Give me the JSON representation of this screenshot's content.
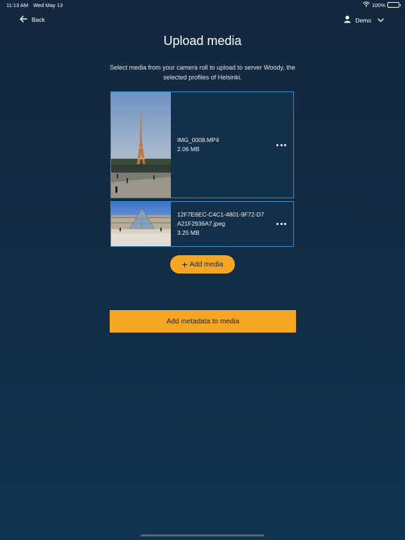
{
  "status_bar": {
    "time": "11:13 AM",
    "date": "Wed May 13",
    "battery": "100%",
    "battery_level": 1.0,
    "wifi_icon": "wifi-icon",
    "battery_icon": "battery-icon"
  },
  "nav": {
    "back_label": "Back",
    "back_icon": "arrow-left-icon",
    "user_label": "Demo",
    "user_icon": "person-icon",
    "chevron_icon": "chevron-down-icon"
  },
  "page": {
    "title": "Upload media",
    "instructions": "Select media from your camera roll to upload to server Woody, the selected profiles of Helsinki."
  },
  "media_items": [
    {
      "name": "IMG_0008.MP4",
      "size": "2.06 MB",
      "more_icon": "more-horizontal-icon"
    },
    {
      "name": "12F7E6EC-C4C1-4801-9F72-D7A21F2936A7.jpeg",
      "size": "3.25 MB",
      "more_icon": "more-horizontal-icon"
    }
  ],
  "buttons": {
    "add_media": "Add media",
    "add_media_icon": "plus-icon",
    "add_metadata": "Add metadata to media"
  },
  "colors": {
    "accent": "#f5a623",
    "card_border": "#2f8ecb",
    "background_top": "#13283f",
    "background_bottom": "#0f3350"
  }
}
